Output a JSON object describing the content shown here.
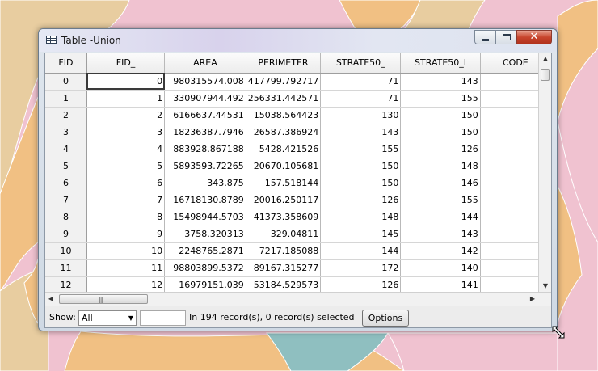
{
  "window": {
    "title": "Table -Union",
    "close_glyph": "✕"
  },
  "table": {
    "columns": [
      "FID",
      "FID_",
      "AREA",
      "PERIMETER",
      "STRATE50_",
      "STRATE50_I",
      "CODE"
    ],
    "rows": [
      [
        "0",
        "0",
        "980315574.008",
        "417799.792717",
        "71",
        "143",
        ""
      ],
      [
        "1",
        "1",
        "330907944.492",
        "256331.442571",
        "71",
        "155",
        ""
      ],
      [
        "2",
        "2",
        "6166637.44531",
        "15038.564423",
        "130",
        "150",
        ""
      ],
      [
        "3",
        "3",
        "18236387.7946",
        "26587.386924",
        "143",
        "150",
        ""
      ],
      [
        "4",
        "4",
        "883928.867188",
        "5428.421526",
        "155",
        "126",
        ""
      ],
      [
        "5",
        "5",
        "5893593.72265",
        "20670.105681",
        "150",
        "148",
        ""
      ],
      [
        "6",
        "6",
        "343.875",
        "157.518144",
        "150",
        "146",
        ""
      ],
      [
        "7",
        "7",
        "16718130.8789",
        "20016.250117",
        "126",
        "155",
        ""
      ],
      [
        "8",
        "8",
        "15498944.5703",
        "41373.358609",
        "148",
        "144",
        ""
      ],
      [
        "9",
        "9",
        "3758.320313",
        "329.04811",
        "145",
        "143",
        ""
      ],
      [
        "10",
        "10",
        "2248765.2871",
        "7217.185088",
        "144",
        "142",
        ""
      ],
      [
        "11",
        "11",
        "98803899.5372",
        "89167.315277",
        "172",
        "140",
        ""
      ],
      [
        "12",
        "12",
        "16979151.039",
        "53184.529573",
        "126",
        "141",
        ""
      ]
    ]
  },
  "footer": {
    "show_label": "Show:",
    "show_value": "All",
    "record_text": "In 194 record(s), 0 record(s) selected",
    "options_label": "Options"
  },
  "colors": {
    "map_pink": "#f0c2d0",
    "map_tan": "#e8cda0",
    "map_orange": "#f1c083",
    "map_teal": "#8fbfc0"
  }
}
